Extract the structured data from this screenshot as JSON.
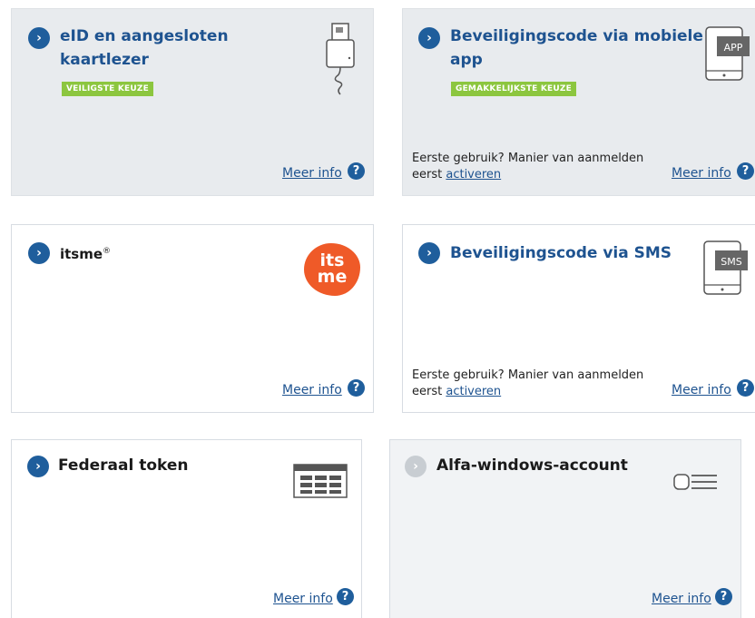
{
  "cards": [
    {
      "title_line1": "eID en aangesloten",
      "title_line2": "kaartlezer",
      "badge": "VEILIGSTE KEUZE",
      "more": "Meer info",
      "icon": "card-reader-icon"
    },
    {
      "title_line1": "Beveiligingscode via mobiele",
      "title_line2": "app",
      "badge": "GEMAKKELIJKSTE KEUZE",
      "note_text": "Eerste gebruik? Manier van aanmelden eerst",
      "note_link": "activeren",
      "more": "Meer info",
      "icon": "phone-app-icon",
      "icon_label": "APP"
    },
    {
      "title": "itsme",
      "title_mark": "®",
      "more": "Meer info",
      "icon": "itsme-logo-icon",
      "logo_line1": "its",
      "logo_line2": "me"
    },
    {
      "title": "Beveiligingscode via SMS",
      "note_text": "Eerste gebruik? Manier van aanmelden eerst",
      "note_link": "activeren",
      "more": "Meer info",
      "icon": "phone-sms-icon",
      "icon_label": "SMS"
    },
    {
      "title": "Federaal token",
      "more": "Meer info",
      "icon": "token-card-icon"
    },
    {
      "title": "Alfa-windows-account",
      "more": "Meer info",
      "icon": "key-account-icon"
    }
  ],
  "question_mark": "?",
  "arrow_glyph": "›",
  "colors": {
    "accent": "#1f5e9c",
    "badge": "#8cc63f",
    "itsme": "#ef5a28",
    "grey_card": "#e8ebee"
  }
}
